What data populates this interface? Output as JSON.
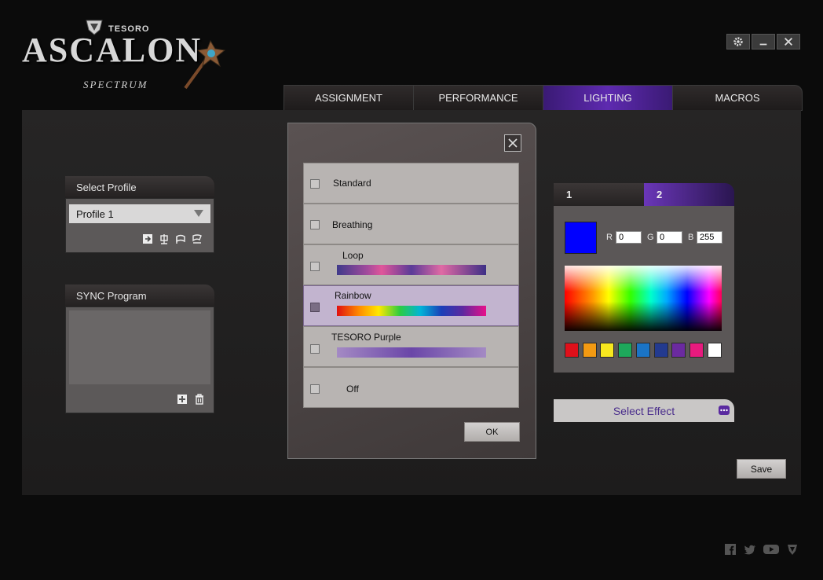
{
  "header": {
    "brand": "TESORO",
    "product_title": "ASCALON",
    "product_subtitle": "SPECTRUM"
  },
  "window_controls": [
    {
      "name": "settings",
      "icon": "gear-icon"
    },
    {
      "name": "minimize",
      "icon": "minimize-icon"
    },
    {
      "name": "close",
      "icon": "close-icon"
    }
  ],
  "tabs": [
    {
      "label": "ASSIGNMENT",
      "active": false
    },
    {
      "label": "PERFORMANCE",
      "active": false
    },
    {
      "label": "LIGHTING",
      "active": true
    },
    {
      "label": "MACROS",
      "active": false
    }
  ],
  "profile_panel": {
    "title": "Select Profile",
    "selected_profile": "Profile 1",
    "actions": [
      "import-icon",
      "export-icon",
      "link-icon",
      "unlink-icon"
    ]
  },
  "sync_panel": {
    "title": "SYNC Program",
    "actions": [
      "add-icon",
      "trash-icon"
    ]
  },
  "effect_dialog": {
    "options": [
      {
        "label": "Standard",
        "selected": false,
        "bar": "none"
      },
      {
        "label": "Breathing",
        "selected": false,
        "bar": "none"
      },
      {
        "label": "Loop",
        "selected": false,
        "bar": "loop"
      },
      {
        "label": "Rainbow",
        "selected": true,
        "bar": "rainbow"
      },
      {
        "label": "TESORO Purple",
        "selected": false,
        "bar": "purple"
      },
      {
        "label": "Off",
        "selected": false,
        "bar": "none"
      }
    ],
    "ok_label": "OK"
  },
  "color_panel": {
    "tabs": [
      {
        "label": "1",
        "active": false
      },
      {
        "label": "2",
        "active": true
      }
    ],
    "current_color": "#0000ff",
    "r_label": "R",
    "r_value": "0",
    "g_label": "G",
    "g_value": "0",
    "b_label": "B",
    "b_value": "255",
    "swatches": [
      "#e0101a",
      "#f39a12",
      "#f8e81e",
      "#1ea85b",
      "#1a74c6",
      "#233a8f",
      "#6b2aa0",
      "#e81a7e",
      "#ffffff"
    ]
  },
  "select_effect_label": "Select Effect",
  "save_label": "Save",
  "social_links": [
    "facebook-icon",
    "twitter-icon",
    "youtube-icon",
    "tesoro-icon"
  ],
  "colors": {
    "accent_purple": "#5e2ab0",
    "panel_gray": "#5c5959"
  }
}
